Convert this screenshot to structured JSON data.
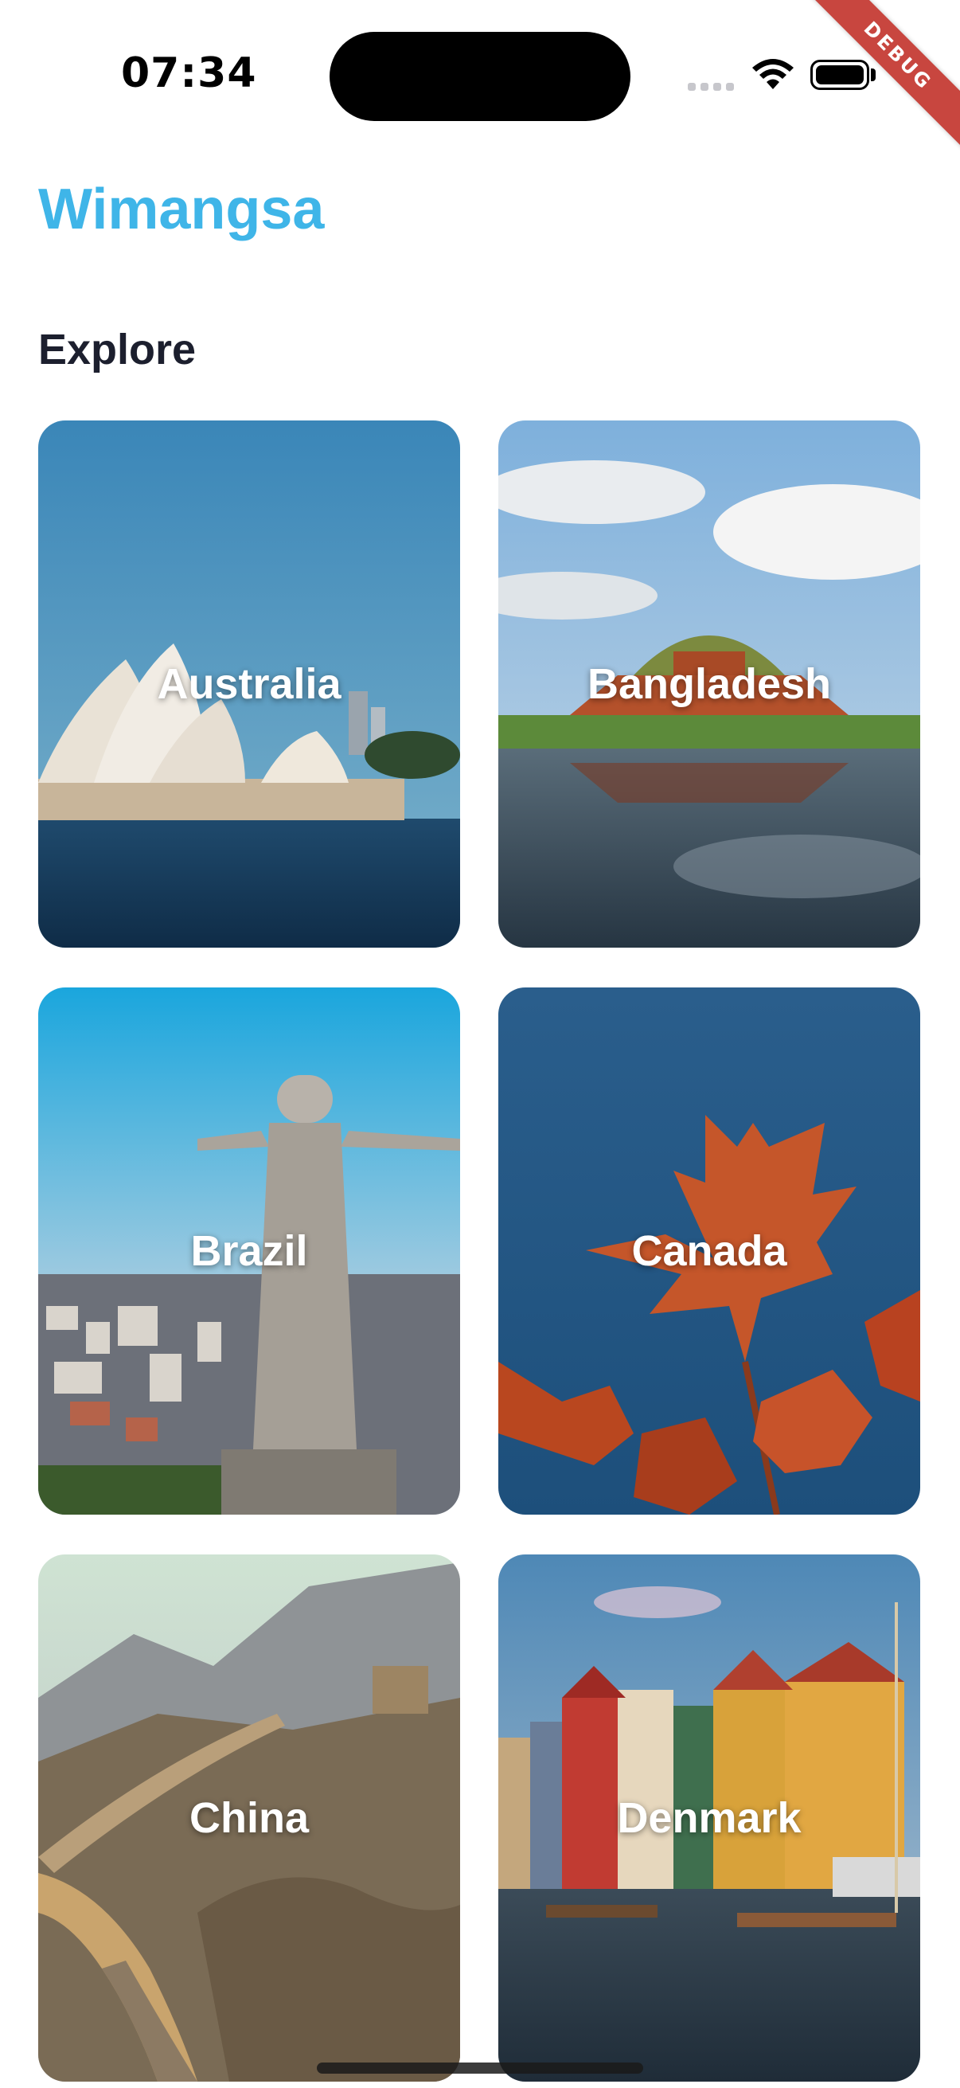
{
  "status_bar": {
    "time": "07:34",
    "debug_banner": "DEBUG"
  },
  "app": {
    "title": "Wimangsa"
  },
  "section": {
    "title": "Explore"
  },
  "countries": [
    {
      "name": "Australia"
    },
    {
      "name": "Bangladesh"
    },
    {
      "name": "Brazil"
    },
    {
      "name": "Canada"
    },
    {
      "name": "China"
    },
    {
      "name": "Denmark"
    }
  ],
  "colors": {
    "title": "#3fb5e8",
    "heading": "#1c1f2e",
    "card_label": "#ffffff"
  }
}
